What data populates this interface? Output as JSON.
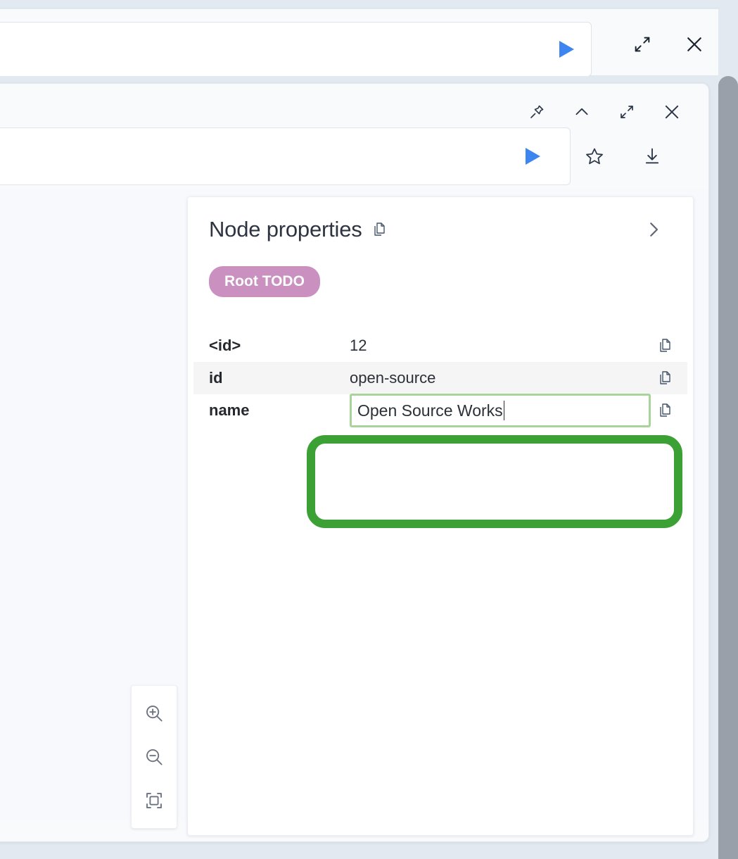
{
  "app": {
    "background_color": "#e3e9f0",
    "canvas_color": "#f8f9fd",
    "accent_blue": "#3d85f0",
    "annotation_green": "#3ba135",
    "input_border_green": "#a8d39b",
    "label_chip_color": "#c990c0"
  },
  "top_panel": {
    "query_value": "",
    "query_placeholder": "",
    "run_icon": "play-icon",
    "expand_icon": "expand-icon",
    "close_icon": "close-icon"
  },
  "main_panel": {
    "window_controls": [
      {
        "name": "pin-icon",
        "label": "Pin"
      },
      {
        "name": "chevron-up-icon",
        "label": "Collapse"
      },
      {
        "name": "expand-icon",
        "label": "Expand"
      },
      {
        "name": "close-icon",
        "label": "Close"
      }
    ],
    "query_value": "",
    "query_placeholder": "",
    "run_icon": "play-icon",
    "query_actions": [
      {
        "name": "star-icon",
        "label": "Save as favorite"
      },
      {
        "name": "download-icon",
        "label": "Download"
      }
    ]
  },
  "zoom_controls": [
    {
      "name": "zoom-in-icon",
      "label": "Zoom in"
    },
    {
      "name": "zoom-out-icon",
      "label": "Zoom out"
    },
    {
      "name": "fit-to-screen-icon",
      "label": "Fit to screen"
    }
  ],
  "node_properties": {
    "title": "Node properties",
    "title_copy_icon": "copy-icon",
    "collapse_icon": "chevron-right-icon",
    "labels": [
      {
        "text": "Root TODO",
        "color": "#c990c0"
      }
    ],
    "rows": [
      {
        "key": "<id>",
        "value": "12",
        "alt": false,
        "editing": false,
        "copy_icon": "copy-icon"
      },
      {
        "key": "id",
        "value": "open-source",
        "alt": true,
        "editing": false,
        "copy_icon": "copy-icon"
      },
      {
        "key": "name",
        "value": "Open Source Works",
        "alt": false,
        "editing": true,
        "copy_icon": "copy-icon"
      }
    ]
  },
  "annotation": {
    "type": "rounded-rect-highlight",
    "color": "#3ba135",
    "targets": "id and name property value fields"
  },
  "scrollbar": {
    "name": "vertical-scrollbar",
    "thumb_color": "#9aa0aa"
  }
}
